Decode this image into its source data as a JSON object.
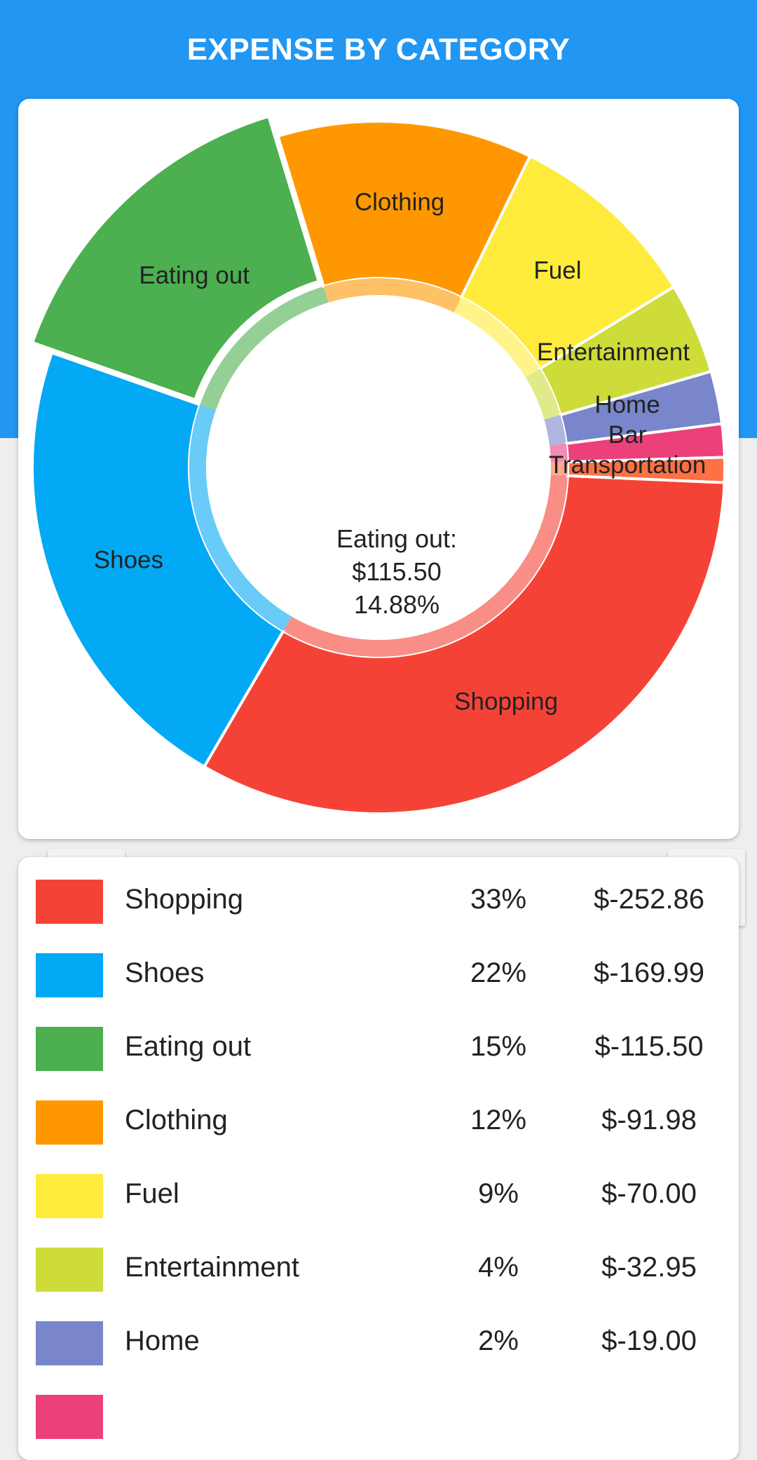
{
  "header": {
    "title": "EXPENSE BY CATEGORY"
  },
  "chart_data": {
    "type": "pie",
    "style": "donut",
    "center_label": {
      "category": "Eating out:",
      "amount": "$115.50",
      "percent": "14.88%"
    },
    "categories": [
      "Shopping",
      "Shoes",
      "Eating out",
      "Clothing",
      "Fuel",
      "Entertainment",
      "Home",
      "Bar",
      "Transportation"
    ],
    "values": [
      252.86,
      169.99,
      115.5,
      91.98,
      70.0,
      32.95,
      19.0,
      12.0,
      9.0
    ],
    "colors": [
      "#f44336",
      "#03a9f4",
      "#4caf50",
      "#ff9800",
      "#ffeb3b",
      "#cddc39",
      "#7986cb",
      "#ec407a",
      "#ff7043"
    ],
    "highlighted": "Eating out"
  },
  "buttons": {
    "toggle_labels": "eye-icon",
    "list_view": "list-icon"
  },
  "legend": [
    {
      "name": "Shopping",
      "percent": "33%",
      "amount": "$-252.86",
      "color": "#f44336"
    },
    {
      "name": "Shoes",
      "percent": "22%",
      "amount": "$-169.99",
      "color": "#03a9f4"
    },
    {
      "name": "Eating out",
      "percent": "15%",
      "amount": "$-115.50",
      "color": "#4caf50"
    },
    {
      "name": "Clothing",
      "percent": "12%",
      "amount": "$-91.98",
      "color": "#ff9800"
    },
    {
      "name": "Fuel",
      "percent": "9%",
      "amount": "$-70.00",
      "color": "#ffeb3b"
    },
    {
      "name": "Entertainment",
      "percent": "4%",
      "amount": "$-32.95",
      "color": "#cddc39"
    },
    {
      "name": "Home",
      "percent": "2%",
      "amount": "$-19.00",
      "color": "#7986cb"
    },
    {
      "name": "",
      "percent": "",
      "amount": "",
      "color": "#ec407a"
    }
  ]
}
